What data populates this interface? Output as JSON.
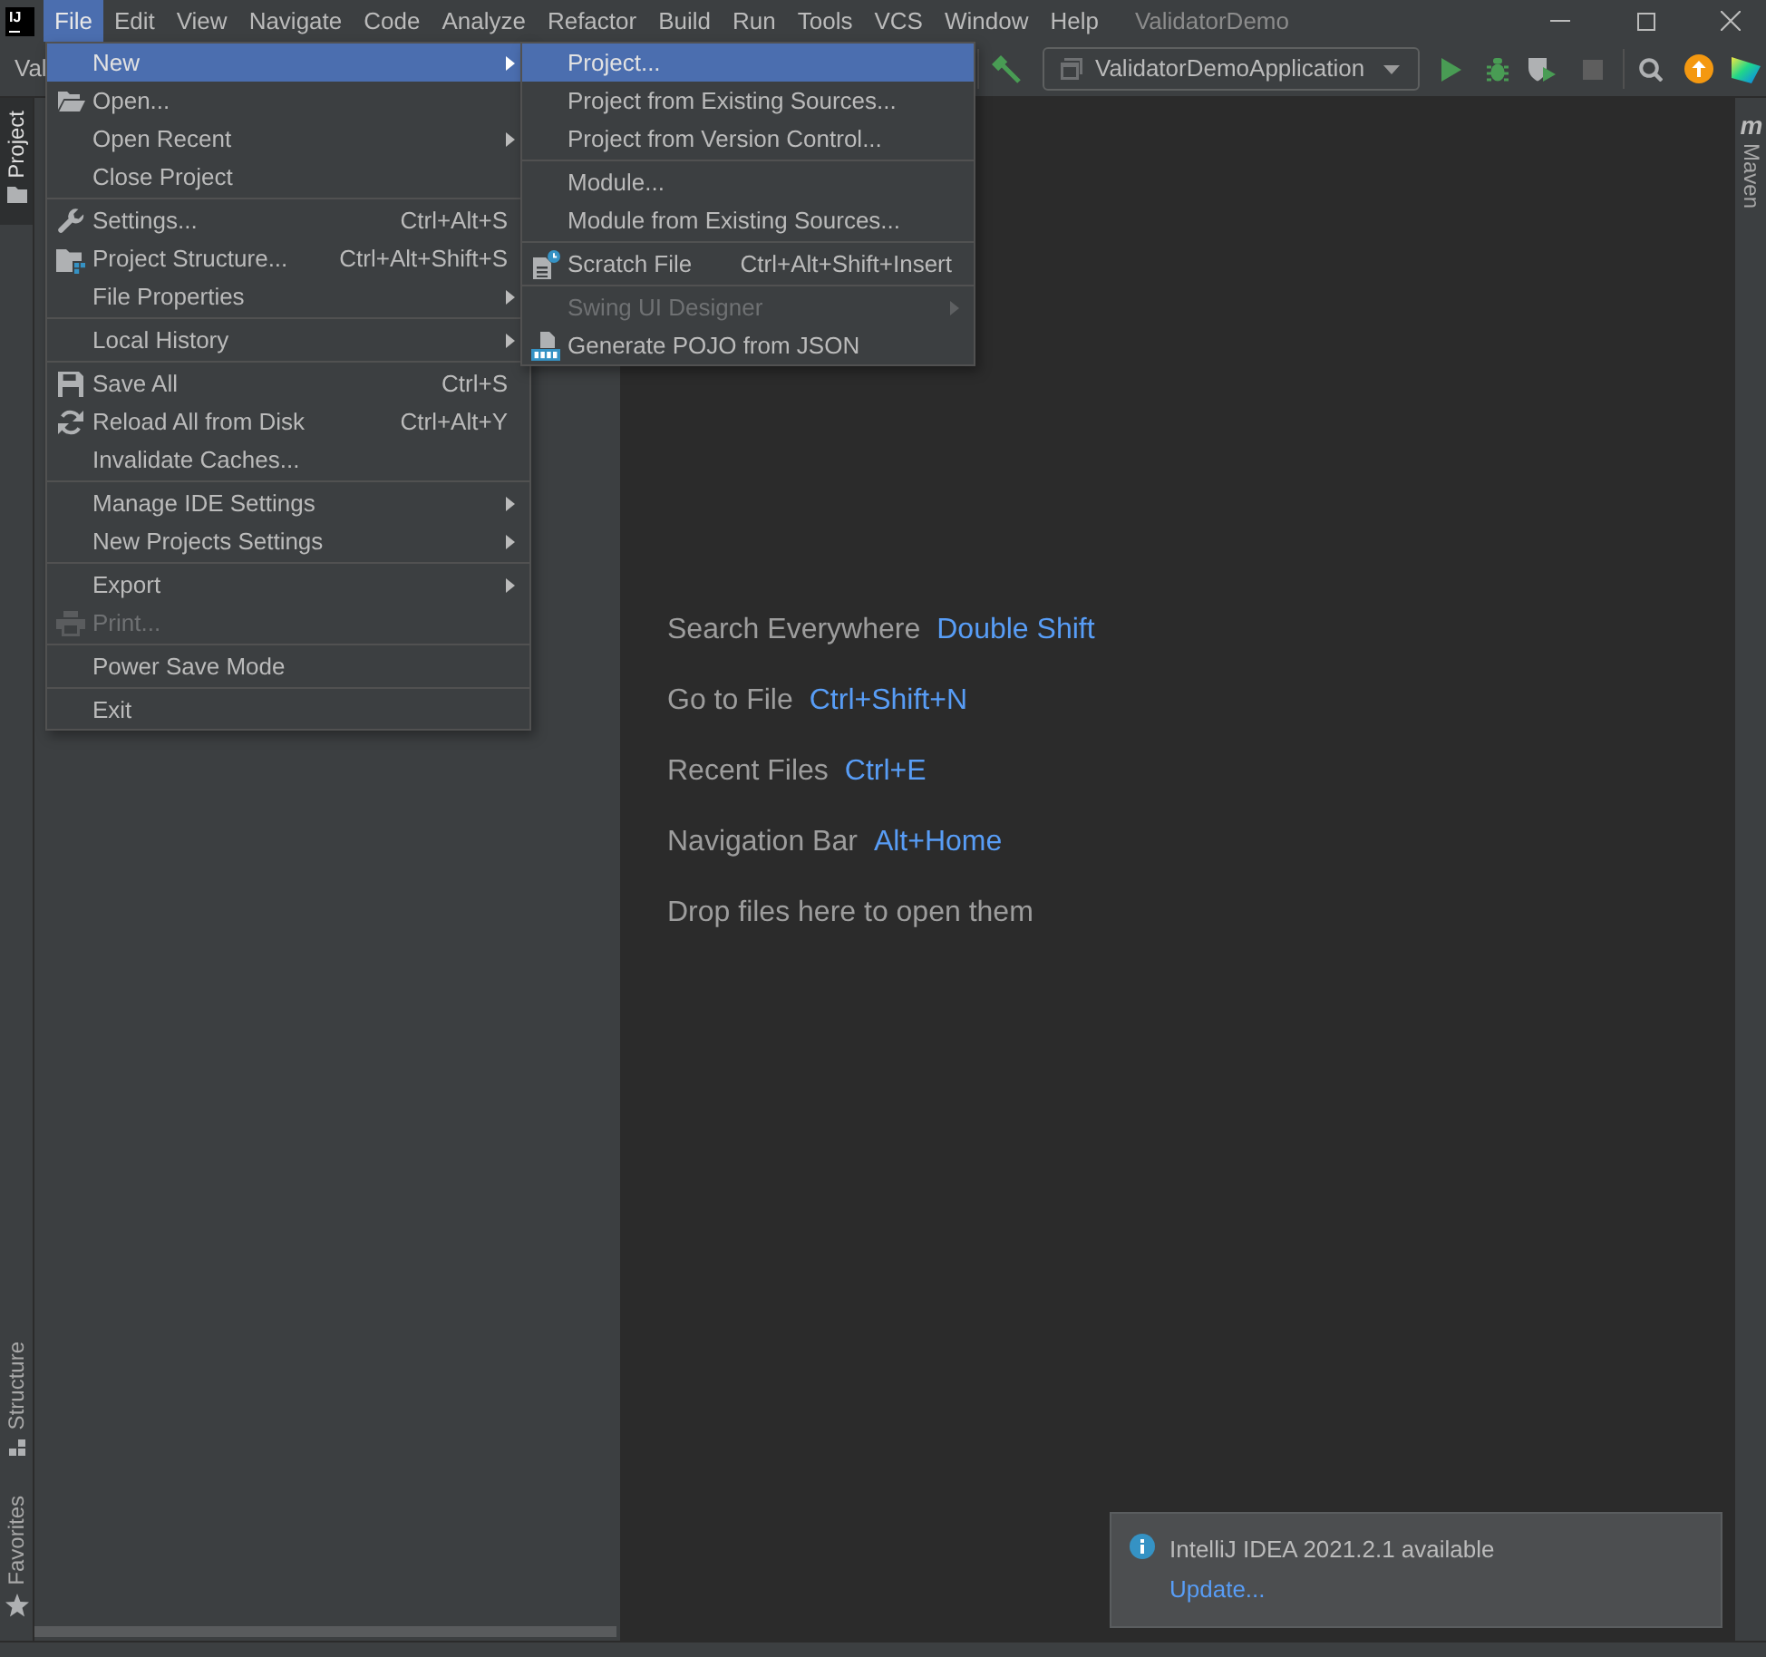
{
  "window": {
    "title": "ValidatorDemo",
    "logo": "IJ"
  },
  "menubar": [
    {
      "label": "File",
      "selected": true
    },
    {
      "label": "Edit",
      "selected": false
    },
    {
      "label": "View",
      "selected": false
    },
    {
      "label": "Navigate",
      "selected": false
    },
    {
      "label": "Code",
      "selected": false
    },
    {
      "label": "Analyze",
      "selected": false
    },
    {
      "label": "Refactor",
      "selected": false
    },
    {
      "label": "Build",
      "selected": false
    },
    {
      "label": "Run",
      "selected": false
    },
    {
      "label": "Tools",
      "selected": false
    },
    {
      "label": "VCS",
      "selected": false
    },
    {
      "label": "Window",
      "selected": false
    },
    {
      "label": "Help",
      "selected": false
    }
  ],
  "toolbar": {
    "breadcrumb": "Val",
    "run_configuration": "ValidatorDemoApplication",
    "stop_button": {
      "disabled": true
    }
  },
  "file_menu": [
    {
      "kind": "item",
      "label": "New",
      "submenu": true,
      "selected": true,
      "disabled": false
    },
    {
      "kind": "item",
      "label": "Open...",
      "submenu": false,
      "selected": false,
      "disabled": false
    },
    {
      "kind": "item",
      "label": "Open Recent",
      "submenu": true,
      "selected": false,
      "disabled": false
    },
    {
      "kind": "item",
      "label": "Close Project",
      "submenu": false,
      "selected": false,
      "disabled": false
    },
    {
      "kind": "separator"
    },
    {
      "kind": "item",
      "label": "Settings...",
      "shortcut": "Ctrl+Alt+S",
      "submenu": false,
      "selected": false,
      "disabled": false
    },
    {
      "kind": "item",
      "label": "Project Structure...",
      "shortcut": "Ctrl+Alt+Shift+S",
      "submenu": false,
      "selected": false,
      "disabled": false
    },
    {
      "kind": "item",
      "label": "File Properties",
      "submenu": true,
      "selected": false,
      "disabled": false
    },
    {
      "kind": "separator"
    },
    {
      "kind": "item",
      "label": "Local History",
      "submenu": true,
      "selected": false,
      "disabled": false
    },
    {
      "kind": "separator"
    },
    {
      "kind": "item",
      "label": "Save All",
      "shortcut": "Ctrl+S",
      "submenu": false,
      "selected": false,
      "disabled": false
    },
    {
      "kind": "item",
      "label": "Reload All from Disk",
      "shortcut": "Ctrl+Alt+Y",
      "submenu": false,
      "selected": false,
      "disabled": false
    },
    {
      "kind": "item",
      "label": "Invalidate Caches...",
      "submenu": false,
      "selected": false,
      "disabled": false
    },
    {
      "kind": "separator"
    },
    {
      "kind": "item",
      "label": "Manage IDE Settings",
      "submenu": true,
      "selected": false,
      "disabled": false
    },
    {
      "kind": "item",
      "label": "New Projects Settings",
      "submenu": true,
      "selected": false,
      "disabled": false
    },
    {
      "kind": "separator"
    },
    {
      "kind": "item",
      "label": "Export",
      "submenu": true,
      "selected": false,
      "disabled": false
    },
    {
      "kind": "item",
      "label": "Print...",
      "submenu": false,
      "selected": false,
      "disabled": true
    },
    {
      "kind": "separator"
    },
    {
      "kind": "item",
      "label": "Power Save Mode",
      "submenu": false,
      "selected": false,
      "disabled": false
    },
    {
      "kind": "separator"
    },
    {
      "kind": "item",
      "label": "Exit",
      "submenu": false,
      "selected": false,
      "disabled": false
    }
  ],
  "new_submenu": [
    {
      "kind": "item",
      "label": "Project...",
      "submenu": false,
      "selected": true,
      "disabled": false
    },
    {
      "kind": "item",
      "label": "Project from Existing Sources...",
      "submenu": false,
      "selected": false,
      "disabled": false
    },
    {
      "kind": "item",
      "label": "Project from Version Control...",
      "submenu": false,
      "selected": false,
      "disabled": false
    },
    {
      "kind": "separator"
    },
    {
      "kind": "item",
      "label": "Module...",
      "submenu": false,
      "selected": false,
      "disabled": false
    },
    {
      "kind": "item",
      "label": "Module from Existing Sources...",
      "submenu": false,
      "selected": false,
      "disabled": false
    },
    {
      "kind": "separator"
    },
    {
      "kind": "item",
      "label": "Scratch File",
      "shortcut": "Ctrl+Alt+Shift+Insert",
      "submenu": false,
      "selected": false,
      "disabled": false
    },
    {
      "kind": "separator"
    },
    {
      "kind": "item",
      "label": "Swing UI Designer",
      "submenu": true,
      "selected": false,
      "disabled": true
    },
    {
      "kind": "item",
      "label": "Generate POJO from JSON",
      "submenu": false,
      "selected": false,
      "disabled": false
    }
  ],
  "left_tool_windows": {
    "top": [
      {
        "label": "Project",
        "selected": true
      }
    ],
    "bottom": [
      {
        "label": "Structure",
        "selected": false
      },
      {
        "label": "Favorites",
        "selected": false
      }
    ]
  },
  "right_tool_windows": [
    {
      "label": "Maven",
      "glyph": "m",
      "selected": false
    }
  ],
  "editor_hints": [
    {
      "label": "Search Everywhere",
      "shortcut": "Double Shift"
    },
    {
      "label": "Go to File",
      "shortcut": "Ctrl+Shift+N"
    },
    {
      "label": "Recent Files",
      "shortcut": "Ctrl+E"
    },
    {
      "label": "Navigation Bar",
      "shortcut": "Alt+Home"
    },
    {
      "label": "Drop files here to open them"
    }
  ],
  "notification": {
    "title": "IntelliJ IDEA 2021.2.1 available",
    "link": "Update..."
  }
}
